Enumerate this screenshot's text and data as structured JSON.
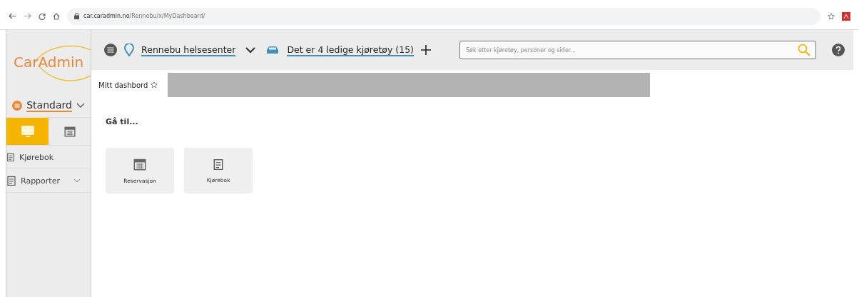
{
  "browser": {
    "url_host": "car.caradmin.no",
    "url_path": "/Rennebu/x/MyDashboard/"
  },
  "sidebar": {
    "logo": "CarAdmin",
    "profile": "Standard",
    "view_tabs": [
      {
        "kind": "dashboard",
        "selected": true
      },
      {
        "kind": "calendar",
        "selected": false
      }
    ],
    "items": [
      {
        "kind": "logbook",
        "label": "Kjørebok",
        "expandable": false
      },
      {
        "kind": "report",
        "label": "Rapporter",
        "expandable": true
      }
    ]
  },
  "topbar": {
    "location": "Rennebu helsesenter",
    "vehicles": "Det er 4 ledige kjøretøy (15)",
    "search": {
      "placeholder": "Søk etter kjøretøy, personer og sider..."
    }
  },
  "tabs": [
    {
      "label": "Mitt dashbord",
      "selected": true
    }
  ],
  "content": {
    "heading": "Gå til...",
    "tiles": [
      {
        "kind": "calendar",
        "label": "Reservasjon"
      },
      {
        "kind": "logbook",
        "label": "Kjørebok"
      }
    ]
  }
}
